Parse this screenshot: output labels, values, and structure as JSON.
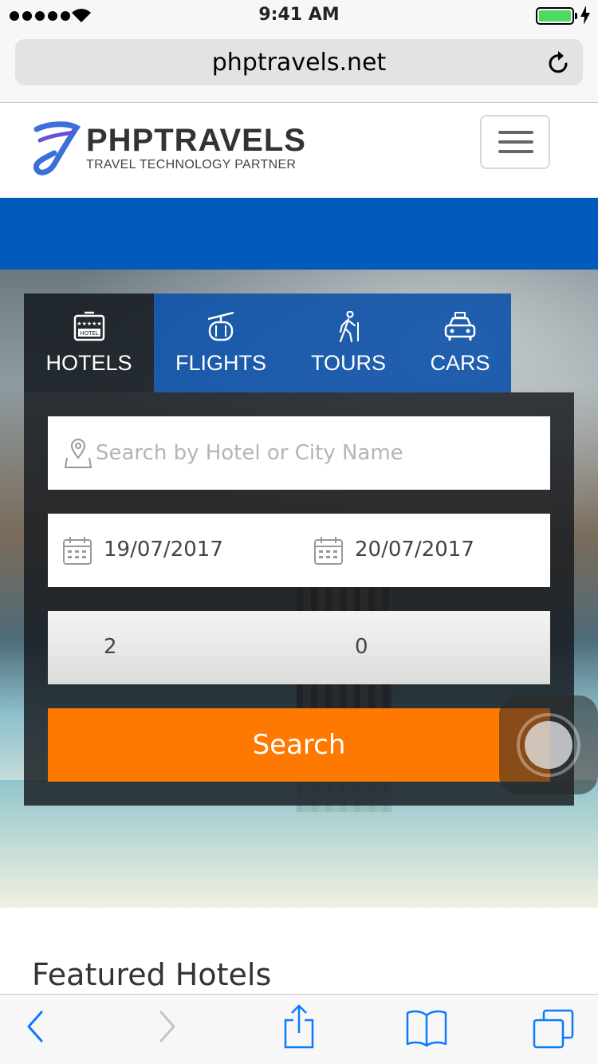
{
  "status_bar": {
    "time": "9:41 AM"
  },
  "browser": {
    "url": "phptravels.net"
  },
  "header": {
    "logo_name": "PHPTRAVELS",
    "logo_tagline": "TRAVEL TECHNOLOGY PARTNER"
  },
  "search": {
    "tabs": [
      {
        "label": "HOTELS",
        "icon": "hotel-icon"
      },
      {
        "label": "FLIGHTS",
        "icon": "cable-car-icon"
      },
      {
        "label": "TOURS",
        "icon": "hiker-icon"
      },
      {
        "label": "CARS",
        "icon": "taxi-icon"
      }
    ],
    "hotel_icon_text": "HOTEL",
    "placeholder": "Search by Hotel or City Name",
    "checkin": "19/07/2017",
    "checkout": "20/07/2017",
    "adults": "2",
    "children": "0",
    "button_label": "Search"
  },
  "featured": {
    "title": "Featured Hotels"
  },
  "colors": {
    "brand_blue": "#005bbb",
    "search_orange": "#ff7800",
    "ios_tint": "#0a7aff"
  }
}
